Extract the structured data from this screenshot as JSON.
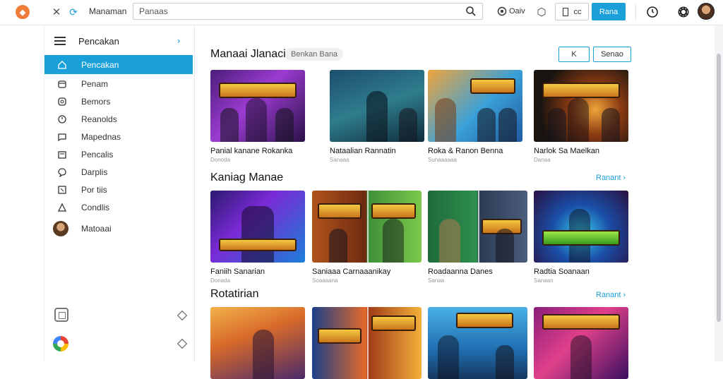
{
  "topbar": {
    "title": "Manaman",
    "search_value": "Panaas",
    "view_label": "Oaiv",
    "box_label": "cc",
    "blue_button": "Rana"
  },
  "sidebar": {
    "title": "Pencakan",
    "items": [
      {
        "label": "Pencakan",
        "icon": "home-icon"
      },
      {
        "label": "Penam",
        "icon": "library-icon"
      },
      {
        "label": "Bemors",
        "icon": "gamepad-icon"
      },
      {
        "label": "Reanolds",
        "icon": "clock-icon"
      },
      {
        "label": "Mapednas",
        "icon": "chat-icon"
      },
      {
        "label": "Pencalis",
        "icon": "store-icon"
      },
      {
        "label": "Darplis",
        "icon": "message-icon"
      },
      {
        "label": "Por tiis",
        "icon": "puzzle-icon"
      },
      {
        "label": "Condlis",
        "icon": "triangle-icon"
      },
      {
        "label": "Matoaai",
        "icon": "user-avatar"
      }
    ]
  },
  "main": {
    "section1": {
      "title": "Manaai Jlanaci",
      "badge": "Benkan Bana",
      "btn_a": "K",
      "btn_b": "Senao",
      "cards": [
        {
          "title": "Panial kanane Rokanka",
          "sub": "Donoda",
          "theme": "purple"
        },
        {
          "title": "Nataalian Rannatin",
          "sub": "Sanaaa",
          "theme": "teal"
        },
        {
          "title": "Roka & Ranon Benna",
          "sub": "Sunaaaaaa",
          "theme": "blue"
        },
        {
          "title": "Narlok Sa Maelkan",
          "sub": "Danaa",
          "theme": "dark"
        }
      ]
    },
    "section2": {
      "title": "Kaniag Manae",
      "more": "Ranant",
      "cards": [
        {
          "title": "Faniih Sanarian",
          "sub": "Donada",
          "theme": "violet"
        },
        {
          "title": "Saniaaa Carnaaanikay",
          "sub": "Soaaaana",
          "theme": "orange"
        },
        {
          "title": "Roadaanna Danes",
          "sub": "Sanaa",
          "theme": "green"
        },
        {
          "title": "Radtia Soanaan",
          "sub": "Sanaan",
          "theme": "navy"
        }
      ]
    },
    "section3": {
      "title": "Rotatirian",
      "more": "Ranant",
      "cards": [
        {
          "theme": "sunset"
        },
        {
          "theme": "fire"
        },
        {
          "theme": "sky"
        },
        {
          "theme": "magenta"
        }
      ]
    }
  },
  "colors": {
    "accent": "#1a9fd8",
    "logo": "#f07c3a"
  }
}
